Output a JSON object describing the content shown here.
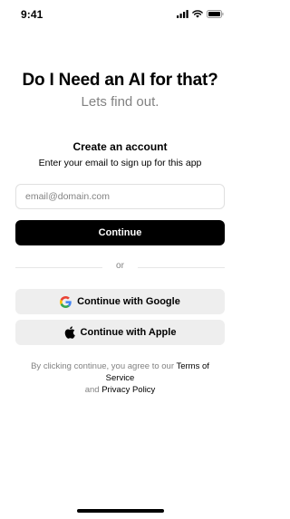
{
  "status_bar": {
    "time": "9:41"
  },
  "hero": {
    "title": "Do I Need an AI for that?",
    "subtitle": "Lets find out."
  },
  "signup": {
    "title": "Create an account",
    "subtitle": "Enter your email to sign up for this app",
    "email_placeholder": "email@domain.com",
    "email_value": "",
    "continue_label": "Continue"
  },
  "divider": {
    "label": "or"
  },
  "social": {
    "google_label": "Continue with Google",
    "apple_label": "Continue with Apple"
  },
  "terms": {
    "prefix": "By clicking continue, you agree to our",
    "terms_link": "Terms of Service",
    "conjunction": "and",
    "privacy_link": "Privacy Policy"
  },
  "colors": {
    "primary": "#000000",
    "muted": "#828282",
    "button_bg": "#eeeeee"
  },
  "icons": [
    "cellular-signal-icon",
    "wifi-icon",
    "battery-icon",
    "google-icon",
    "apple-icon"
  ]
}
